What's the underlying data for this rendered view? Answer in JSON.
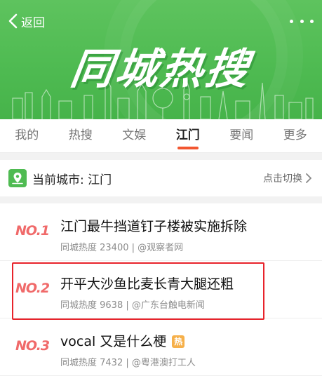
{
  "header": {
    "back_label": "返回",
    "title": "同城热搜"
  },
  "tabs": [
    {
      "label": "我的",
      "active": false
    },
    {
      "label": "热搜",
      "active": false
    },
    {
      "label": "文娱",
      "active": false
    },
    {
      "label": "江门",
      "active": true
    },
    {
      "label": "要闻",
      "active": false
    },
    {
      "label": "更多",
      "active": false
    }
  ],
  "city": {
    "label": "当前城市: 江门",
    "switch_label": "点击切换"
  },
  "items": [
    {
      "rank": "NO.1",
      "title": "江门最牛挡道钉子楼被实施拆除",
      "meta": "同城热度 23400 | @观察者网",
      "hot": false
    },
    {
      "rank": "NO.2",
      "title": "开平大沙鱼比麦长青大腿还粗",
      "meta": "同城热度 9638 | @广东台触电新闻",
      "hot": false
    },
    {
      "rank": "NO.3",
      "title": "vocal 又是什么梗",
      "meta": "同城热度 7432 | @粤港澳打工人",
      "hot": true,
      "badge": "热"
    }
  ],
  "colors": {
    "banner_green": "#4fbb52",
    "accent_orange": "#f25630",
    "rank_red": "#f06a6a",
    "highlight_red": "#e8232b",
    "hot_badge": "#f6b04a"
  }
}
